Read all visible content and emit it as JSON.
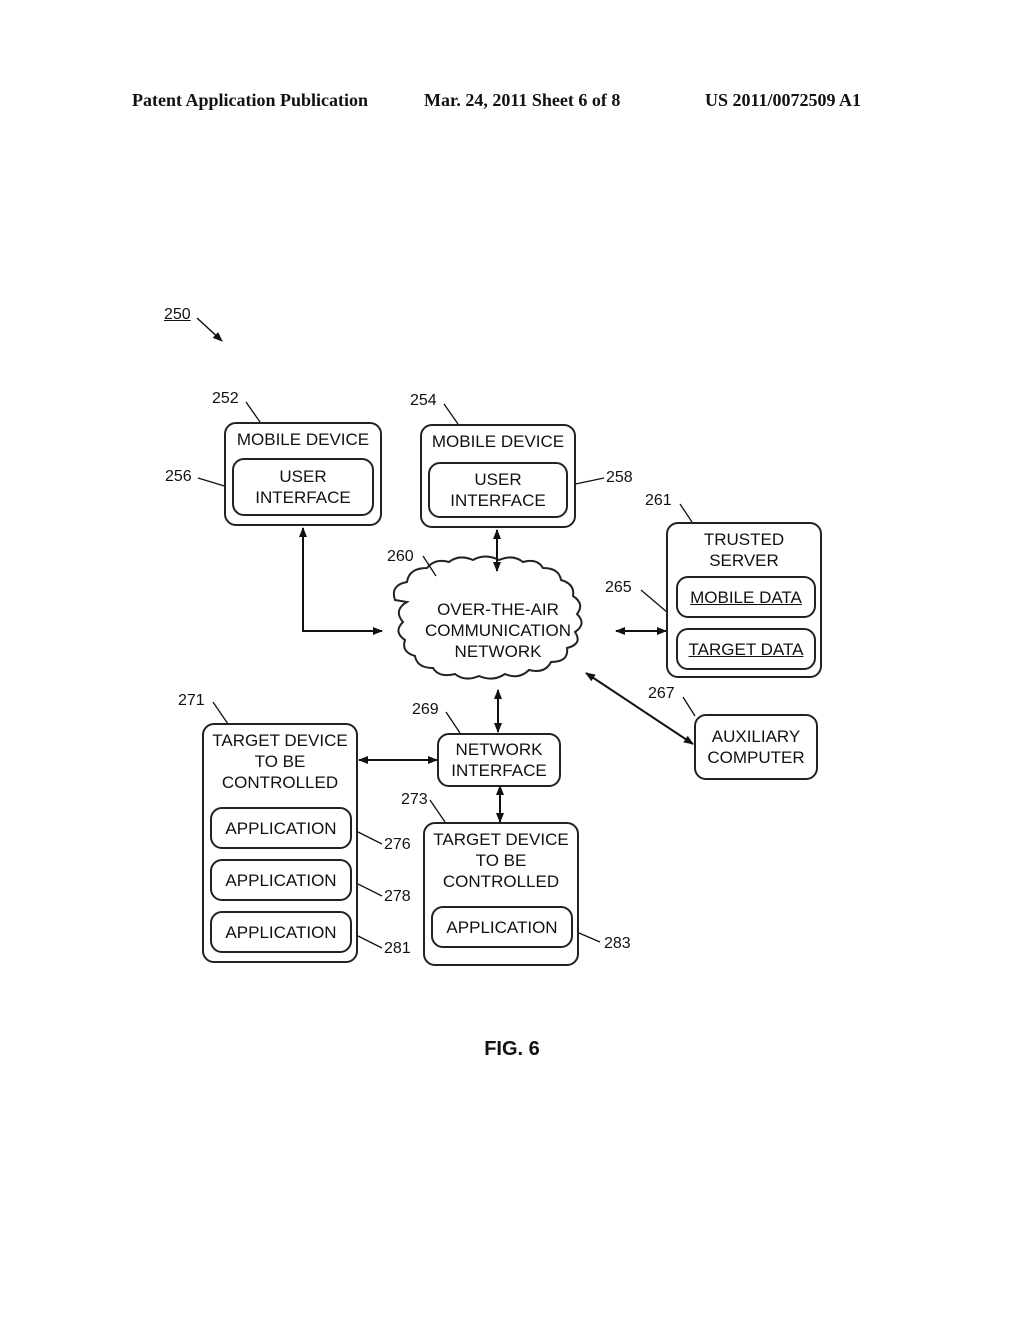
{
  "header": {
    "left": "Patent Application Publication",
    "center": "Mar. 24, 2011  Sheet 6 of 8",
    "right": "US 2011/0072509 A1"
  },
  "figure": {
    "ref": "250",
    "caption": "FIG. 6",
    "mobile_device_1": {
      "ref": "252",
      "title": "MOBILE DEVICE",
      "ui_ref": "256",
      "ui_line1": "USER",
      "ui_line2": "INTERFACE"
    },
    "mobile_device_2": {
      "ref": "254",
      "title": "MOBILE DEVICE",
      "ui_ref": "258",
      "ui_line1": "USER",
      "ui_line2": "INTERFACE"
    },
    "network": {
      "ref": "260",
      "line1": "OVER-THE-AIR",
      "line2": "COMMUNICATION",
      "line3": "NETWORK"
    },
    "trusted_server": {
      "ref": "261",
      "line1": "TRUSTED",
      "line2": "SERVER",
      "data_ref": "265",
      "mobile_data": "MOBILE DATA",
      "target_data": "TARGET DATA"
    },
    "auxiliary": {
      "ref": "267",
      "line1": "AUXILIARY",
      "line2": "COMPUTER"
    },
    "network_interface": {
      "ref": "269",
      "line1": "NETWORK",
      "line2": "INTERFACE"
    },
    "target_device_1": {
      "ref": "271",
      "line1": "TARGET DEVICE",
      "line2": "TO BE",
      "line3": "CONTROLLED",
      "apps": [
        {
          "label": "APPLICATION",
          "ref": "276"
        },
        {
          "label": "APPLICATION",
          "ref": "278"
        },
        {
          "label": "APPLICATION",
          "ref": "281"
        }
      ]
    },
    "target_device_2": {
      "ref": "273",
      "line1": "TARGET DEVICE",
      "line2": "TO BE",
      "line3": "CONTROLLED",
      "app": {
        "label": "APPLICATION",
        "ref": "283"
      }
    }
  }
}
